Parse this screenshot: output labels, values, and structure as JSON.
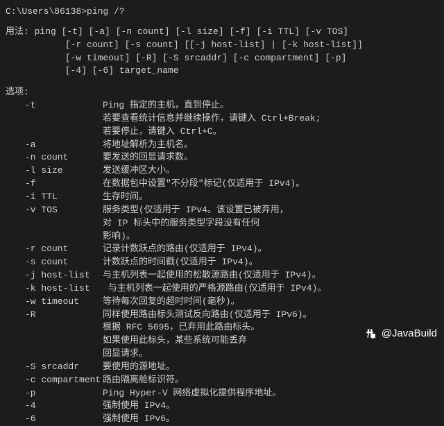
{
  "prompt": "C:\\Users\\86138>ping /?",
  "usage_label": "用法:",
  "usage_lines": [
    "ping [-t] [-a] [-n count] [-l size] [-f] [-i TTL] [-v TOS]",
    "[-r count] [-s count] [[-j host-list] | [-k host-list]]",
    "[-w timeout] [-R] [-S srcaddr] [-c compartment] [-p]",
    "[-4] [-6] target_name"
  ],
  "options_label": "选项:",
  "options": [
    {
      "flag": "-t",
      "desc": [
        "Ping 指定的主机，直到停止。",
        "若要查看统计信息并继续操作，请键入 Ctrl+Break;",
        "若要停止，请键入 Ctrl+C。"
      ]
    },
    {
      "flag": "-a",
      "desc": [
        "将地址解析为主机名。"
      ]
    },
    {
      "flag": "-n count",
      "desc": [
        "要发送的回显请求数。"
      ]
    },
    {
      "flag": "-l size",
      "desc": [
        "发送缓冲区大小。"
      ]
    },
    {
      "flag": "-f",
      "desc": [
        "在数据包中设置\"不分段\"标记(仅适用于 IPv4)。"
      ]
    },
    {
      "flag": "-i TTL",
      "desc": [
        "生存时间。"
      ]
    },
    {
      "flag": "-v TOS",
      "desc": [
        "服务类型(仅适用于 IPv4。该设置已被弃用，",
        "对 IP 标头中的服务类型字段没有任何",
        "影响)。"
      ]
    },
    {
      "flag": "-r count",
      "desc": [
        "记录计数跃点的路由(仅适用于 IPv4)。"
      ]
    },
    {
      "flag": "-s count",
      "desc": [
        "计数跃点的时间戳(仅适用于 IPv4)。"
      ]
    },
    {
      "flag": "-j host-list",
      "desc": [
        "与主机列表一起使用的松散源路由(仅适用于 IPv4)。"
      ]
    },
    {
      "flag": "-k host-list",
      "desc": [
        " 与主机列表一起使用的严格源路由(仅适用于 IPv4)。"
      ]
    },
    {
      "flag": "-w timeout",
      "desc": [
        "等待每次回复的超时时间(毫秒)。"
      ]
    },
    {
      "flag": "-R",
      "desc": [
        "同样使用路由标头测试反向路由(仅适用于 IPv6)。",
        "根据 RFC 5095，已弃用此路由标头。",
        "如果使用此标头，某些系统可能丢弃",
        "回显请求。"
      ]
    },
    {
      "flag": "-S srcaddr",
      "desc": [
        "要使用的源地址。"
      ]
    },
    {
      "flag": "-c compartment",
      "desc": [
        "路由隔离舱标识符。"
      ]
    },
    {
      "flag": "-p",
      "desc": [
        "Ping Hyper-V 网络虚拟化提供程序地址。"
      ]
    },
    {
      "flag": "-4",
      "desc": [
        "强制使用 IPv4。"
      ]
    },
    {
      "flag": "-6",
      "desc": [
        "强制使用 IPv6。"
      ]
    }
  ],
  "watermark": "@JavaBuild"
}
